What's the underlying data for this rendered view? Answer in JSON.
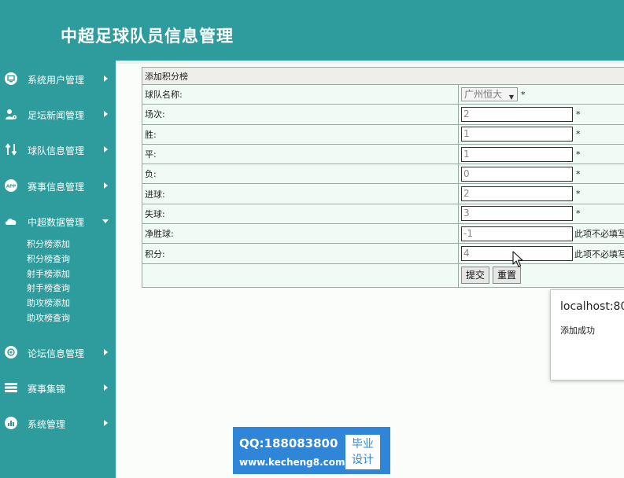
{
  "app": {
    "title": "中超足球队员信息管理"
  },
  "sidebar": {
    "items": [
      {
        "label": "系统用户管理",
        "icon": "monitor-icon"
      },
      {
        "label": "足坛新闻管理",
        "icon": "user-gear-icon"
      },
      {
        "label": "球队信息管理",
        "icon": "transfer-icon"
      },
      {
        "label": "赛事信息管理",
        "icon": "app-icon"
      },
      {
        "label": "中超数据管理",
        "icon": "cloud-icon"
      },
      {
        "label": "论坛信息管理",
        "icon": "settings-icon"
      },
      {
        "label": "赛事集锦",
        "icon": "layers-icon"
      },
      {
        "label": "系统管理",
        "icon": "chart-icon"
      }
    ],
    "submenu": [
      "积分榜添加",
      "积分榜查询",
      "射手榜添加",
      "射手榜查询",
      "助攻榜添加",
      "助攻榜查询"
    ]
  },
  "form": {
    "header": "添加积分榜",
    "team": {
      "label": "球队名称:",
      "value": "广州恒大",
      "required": "*"
    },
    "fields": [
      {
        "label": "场次:",
        "value": "2",
        "suffix": "*"
      },
      {
        "label": "胜:",
        "value": "1",
        "suffix": "*"
      },
      {
        "label": "平:",
        "value": "1",
        "suffix": "*"
      },
      {
        "label": "负:",
        "value": "0",
        "suffix": "*"
      },
      {
        "label": "进球:",
        "value": "2",
        "suffix": "*"
      },
      {
        "label": "失球:",
        "value": "3",
        "suffix": "*"
      },
      {
        "label": "净胜球:",
        "value": "-1",
        "suffix": "此项不必填写"
      },
      {
        "label": "积分:",
        "value": "4",
        "suffix": "此项不必填写"
      }
    ],
    "buttons": {
      "submit": "提交",
      "reset": "重置"
    }
  },
  "alert": {
    "title": "localhost:80",
    "message": "添加成功"
  },
  "watermark": {
    "qq": "QQ:188083800",
    "url": "www.kecheng8.com",
    "badge_line1": "毕业",
    "badge_line2": "设计"
  },
  "colors": {
    "sidebar": "#2e9c9c",
    "main_bg": "#fbfdfa",
    "table_bg": "#f0fbf6",
    "watermark": "#2f86d8"
  }
}
